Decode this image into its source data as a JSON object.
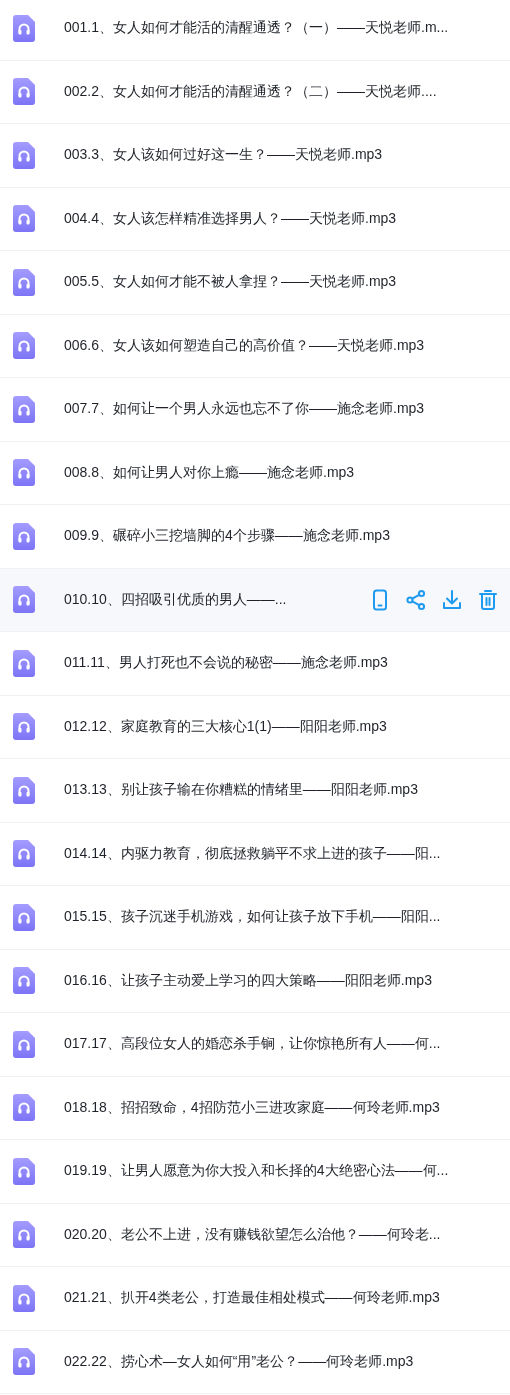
{
  "files": [
    {
      "name": "001.1、女人如何才能活的清醒通透？（一）——天悦老师.m...",
      "highlighted": false
    },
    {
      "name": "002.2、女人如何才能活的清醒通透？（二）——天悦老师....",
      "highlighted": false
    },
    {
      "name": "003.3、女人该如何过好这一生？——天悦老师.mp3",
      "highlighted": false
    },
    {
      "name": "004.4、女人该怎样精准选择男人？——天悦老师.mp3",
      "highlighted": false
    },
    {
      "name": "005.5、女人如何才能不被人拿捏？——天悦老师.mp3",
      "highlighted": false
    },
    {
      "name": "006.6、女人该如何塑造自己的高价值？——天悦老师.mp3",
      "highlighted": false
    },
    {
      "name": "007.7、如何让一个男人永远也忘不了你——施念老师.mp3",
      "highlighted": false
    },
    {
      "name": "008.8、如何让男人对你上瘾——施念老师.mp3",
      "highlighted": false
    },
    {
      "name": "009.9、碾碎小三挖墙脚的4个步骤——施念老师.mp3",
      "highlighted": false
    },
    {
      "name": "010.10、四招吸引优质的男人——...",
      "highlighted": true
    },
    {
      "name": "011.11、男人打死也不会说的秘密——施念老师.mp3",
      "highlighted": false
    },
    {
      "name": "012.12、家庭教育的三大核心1(1)——阳阳老师.mp3",
      "highlighted": false
    },
    {
      "name": "013.13、别让孩子输在你糟糕的情绪里——阳阳老师.mp3",
      "highlighted": false
    },
    {
      "name": "014.14、内驱力教育，彻底拯救躺平不求上进的孩子——阳...",
      "highlighted": false
    },
    {
      "name": "015.15、孩子沉迷手机游戏，如何让孩子放下手机——阳阳...",
      "highlighted": false
    },
    {
      "name": "016.16、让孩子主动爱上学习的四大策略——阳阳老师.mp3",
      "highlighted": false
    },
    {
      "name": "017.17、高段位女人的婚恋杀手锏，让你惊艳所有人——何...",
      "highlighted": false
    },
    {
      "name": "018.18、招招致命，4招防范小三进攻家庭——何玲老师.mp3",
      "highlighted": false
    },
    {
      "name": "019.19、让男人愿意为你大投入和长择的4大绝密心法——何...",
      "highlighted": false
    },
    {
      "name": "020.20、老公不上进，没有赚钱欲望怎么治他？——何玲老...",
      "highlighted": false
    },
    {
      "name": "021.21、扒开4类老公，打造最佳相处模式——何玲老师.mp3",
      "highlighted": false
    },
    {
      "name": "022.22、捞心术—女人如何“用”老公？——何玲老师.mp3",
      "highlighted": false
    }
  ]
}
